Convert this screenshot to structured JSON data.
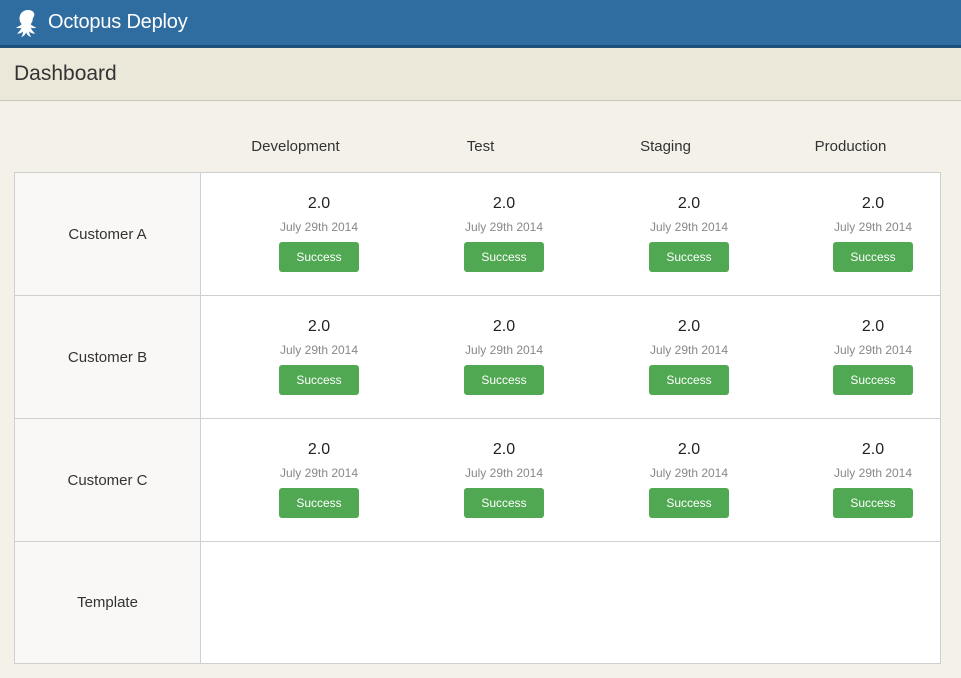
{
  "app": {
    "name": "Octopus Deploy"
  },
  "page": {
    "title": "Dashboard"
  },
  "environments": [
    "Development",
    "Test",
    "Staging",
    "Production"
  ],
  "rows": [
    {
      "label": "Customer A",
      "cells": [
        {
          "version": "2.0",
          "date": "July 29th 2014",
          "status": "Success"
        },
        {
          "version": "2.0",
          "date": "July 29th 2014",
          "status": "Success"
        },
        {
          "version": "2.0",
          "date": "July 29th 2014",
          "status": "Success"
        },
        {
          "version": "2.0",
          "date": "July 29th 2014",
          "status": "Success"
        }
      ]
    },
    {
      "label": "Customer B",
      "cells": [
        {
          "version": "2.0",
          "date": "July 29th 2014",
          "status": "Success"
        },
        {
          "version": "2.0",
          "date": "July 29th 2014",
          "status": "Success"
        },
        {
          "version": "2.0",
          "date": "July 29th 2014",
          "status": "Success"
        },
        {
          "version": "2.0",
          "date": "July 29th 2014",
          "status": "Success"
        }
      ]
    },
    {
      "label": "Customer C",
      "cells": [
        {
          "version": "2.0",
          "date": "July 29th 2014",
          "status": "Success"
        },
        {
          "version": "2.0",
          "date": "July 29th 2014",
          "status": "Success"
        },
        {
          "version": "2.0",
          "date": "July 29th 2014",
          "status": "Success"
        },
        {
          "version": "2.0",
          "date": "July 29th 2014",
          "status": "Success"
        }
      ]
    },
    {
      "label": "Template",
      "cells": []
    }
  ],
  "colors": {
    "topbar": "#2f6c9f",
    "success": "#50a853",
    "background": "#f4f1e8"
  },
  "icons": {
    "logo": "octopus-logo-icon"
  }
}
